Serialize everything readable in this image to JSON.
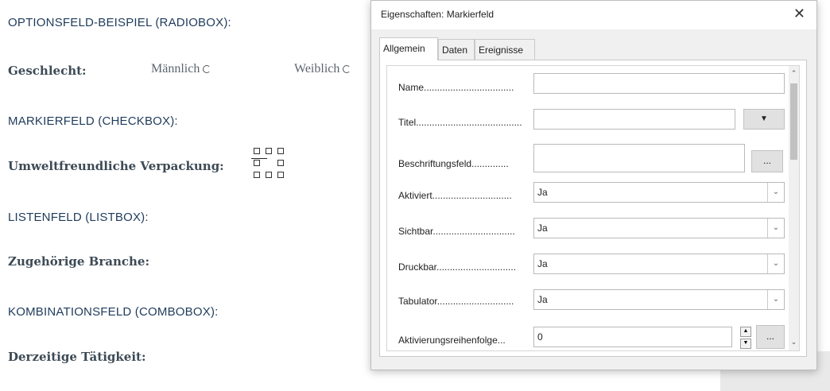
{
  "document": {
    "headings": {
      "radio": "OPTIONSFELD-BEISPIEL (RADIOBOX):",
      "checkbox": "MARKIERFELD (CHECKBOX):",
      "listbox": "LISTENFELD (LISTBOX):",
      "combobox": "KOMBINATIONSFELD (COMBOBOX):"
    },
    "labels": {
      "gender": "Geschlecht:",
      "packaging": "Umweltfreundliche Verpackung:",
      "industry": "Zugehörige Branche:",
      "occupation": "Derzeitige Tätigkeit:"
    },
    "options": {
      "male": "Männlich",
      "female": "Weiblich"
    }
  },
  "dialog": {
    "title": "Eigenschaften: Markierfeld",
    "close_symbol": "✕",
    "tabs": [
      "Allgemein",
      "Daten",
      "Ereignisse"
    ],
    "active_tab": "Allgemein",
    "rows": {
      "name": {
        "label": "Name..................................",
        "value": ""
      },
      "titel": {
        "label": "Titel........................................",
        "value": "",
        "button": "▼"
      },
      "beschriftung": {
        "label": "Beschriftungsfeld..............",
        "value": "",
        "button": "..."
      },
      "aktiviert": {
        "label": "Aktiviert..............................",
        "value": "Ja"
      },
      "sichtbar": {
        "label": "Sichtbar...............................",
        "value": "Ja"
      },
      "druckbar": {
        "label": "Druckbar..............................",
        "value": "Ja"
      },
      "tabulator": {
        "label": "Tabulator.............................",
        "value": "Ja"
      },
      "reihenfolge": {
        "label": "Aktivierungsreihenfolge...",
        "value": "0",
        "button": "..."
      }
    }
  }
}
